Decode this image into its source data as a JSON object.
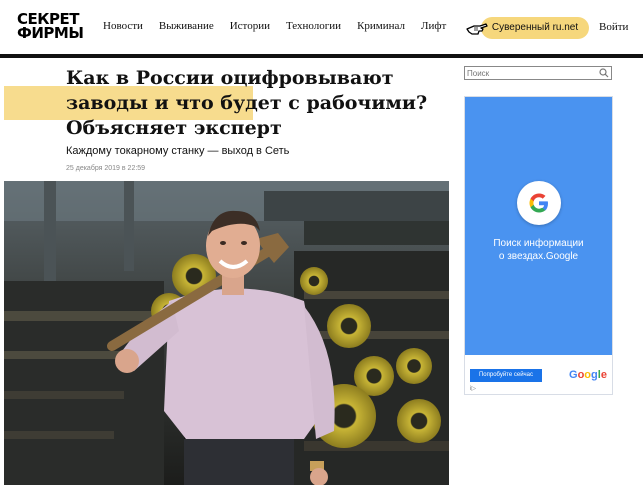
{
  "header": {
    "logo_line1": "СЕКРЕТ",
    "logo_line2": "ФИРМЫ",
    "nav": [
      "Новости",
      "Выживание",
      "Истории",
      "Технологии",
      "Криминал",
      "Лифт"
    ],
    "promo_label": "Суверенный ru.net",
    "login_label": "Войти"
  },
  "article": {
    "title": "Как в России оцифровывают заводы и что будет с рабочими? Объясняет эксперт",
    "subtitle": "Каждому токарному станку — выход в Сеть",
    "date": "25 декабря 2019 в 22:59"
  },
  "sidebar": {
    "search_placeholder": "Поиск",
    "ad": {
      "text_line1": "Поиск информации",
      "text_line2": "о звездах.Google",
      "button_label": "Попробуйте сейчас",
      "brand": "Google",
      "info": "i▷"
    }
  },
  "colors": {
    "accent_yellow": "#f6d77c",
    "ad_blue": "#4a93f0",
    "google_button": "#1a73e8"
  },
  "icons": [
    "hand-pointing-icon",
    "search-icon",
    "google-g-icon",
    "ad-info-icon"
  ]
}
